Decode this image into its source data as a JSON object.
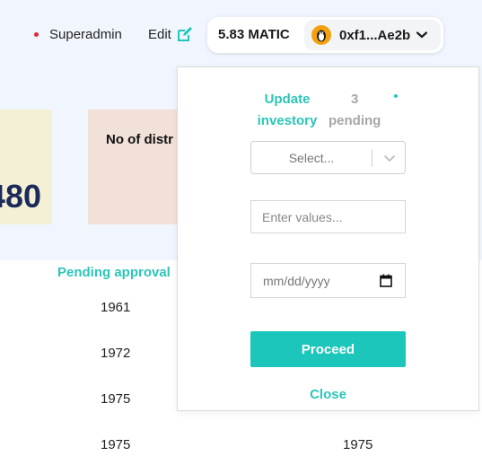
{
  "header": {
    "role_label": "Superadmin",
    "edit_label": "Edit",
    "balance": "5.83 MATIC",
    "address": "0xf1...Ae2b",
    "accent_color": "#2cc5b8"
  },
  "cards": {
    "left_value": "480",
    "middle_title": "No of distr"
  },
  "table": {
    "column_header": "Pending approval",
    "rows": [
      {
        "col1": "1961",
        "col2": ""
      },
      {
        "col1": "1972",
        "col2": ""
      },
      {
        "col1": "1975",
        "col2": ""
      },
      {
        "col1": "1975",
        "col2": "1975"
      }
    ]
  },
  "popup": {
    "title_line1": "Update",
    "title_line2": "investory",
    "count_line1": "3",
    "count_line2": "pending",
    "select_placeholder": "Select...",
    "input_placeholder": "Enter values...",
    "date_placeholder": "mm/dd/yyyy",
    "proceed_label": "Proceed",
    "close_label": "Close"
  },
  "icons": {
    "edit": "edit-pencil-icon",
    "avatar": "penguin-avatar-icon",
    "account_chevron": "chevron-down-icon",
    "select_chevron": "chevron-down-icon",
    "calendar": "calendar-icon"
  }
}
